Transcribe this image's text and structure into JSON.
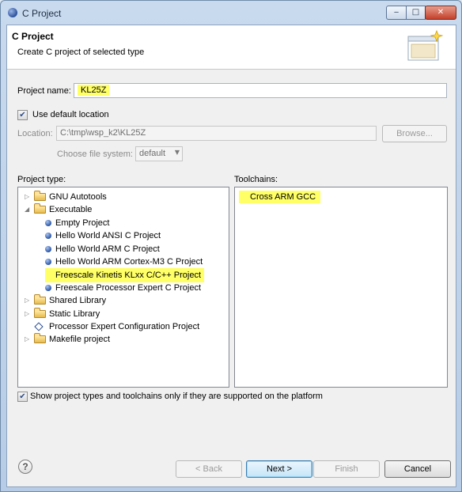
{
  "window": {
    "title": "C Project",
    "controls": {
      "minimize": "‒",
      "maximize": "□",
      "close": "✕"
    }
  },
  "banner": {
    "title": "C Project",
    "subtitle": "Create C project of selected type"
  },
  "project_name": {
    "label": "Project name:",
    "value": "KL25Z"
  },
  "use_default_location": {
    "label": "Use default location",
    "checked": true,
    "check_glyph": "✔"
  },
  "location": {
    "label": "Location:",
    "value": "C:\\tmp\\wsp_k2\\KL25Z",
    "browse_label": "Browse..."
  },
  "file_system": {
    "label": "Choose file system:",
    "value": "default",
    "arrow": "▼"
  },
  "project_type": {
    "label": "Project type:",
    "items": [
      {
        "label": "GNU Autotools",
        "kind": "folder",
        "level": 0,
        "expander": "▷"
      },
      {
        "label": "Executable",
        "kind": "folder",
        "level": 0,
        "expander": "◢"
      },
      {
        "label": "Empty Project",
        "kind": "item",
        "level": 1
      },
      {
        "label": "Hello World ANSI C Project",
        "kind": "item",
        "level": 1
      },
      {
        "label": "Hello World ARM C Project",
        "kind": "item",
        "level": 1
      },
      {
        "label": "Hello World ARM Cortex-M3 C Project",
        "kind": "item",
        "level": 1
      },
      {
        "label": "Freescale Kinetis KLxx C/C++ Project",
        "kind": "item",
        "level": 1,
        "highlighted": true
      },
      {
        "label": "Freescale Processor Expert C Project",
        "kind": "item",
        "level": 1
      },
      {
        "label": "Shared Library",
        "kind": "folder",
        "level": 0,
        "expander": "▷"
      },
      {
        "label": "Static Library",
        "kind": "folder",
        "level": 0,
        "expander": "▷"
      },
      {
        "label": "Processor Expert Configuration Project",
        "kind": "diamond",
        "level": 0
      },
      {
        "label": "Makefile project",
        "kind": "folder",
        "level": 0,
        "expander": "▷"
      }
    ]
  },
  "toolchains": {
    "label": "Toolchains:",
    "items": [
      {
        "label": "Cross ARM GCC",
        "highlighted": true
      }
    ]
  },
  "filter_checkbox": {
    "label": "Show project types and toolchains only if they are supported on the platform",
    "checked": true,
    "check_glyph": "✔"
  },
  "help": {
    "glyph": "?"
  },
  "buttons": {
    "back": "< Back",
    "next": "Next >",
    "finish": "Finish",
    "cancel": "Cancel"
  },
  "colors": {
    "highlight": "#ffff66",
    "title_bar": "#c9daee",
    "default_button_border": "#3c7fb1"
  }
}
